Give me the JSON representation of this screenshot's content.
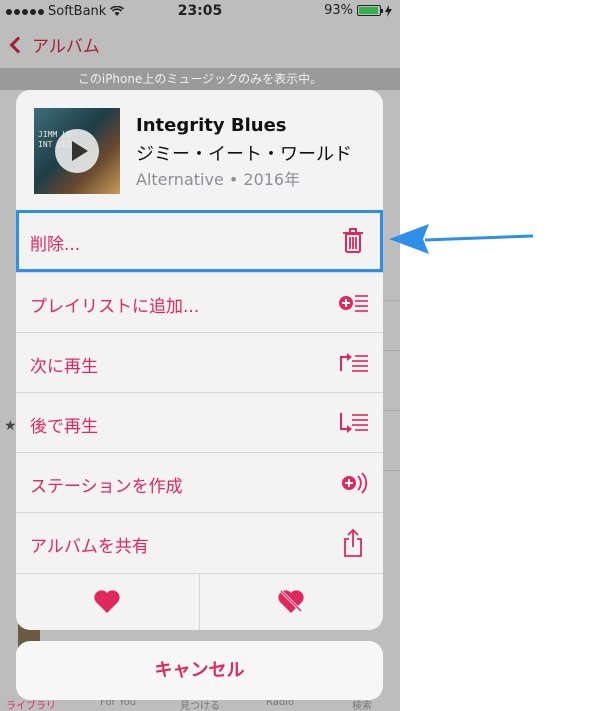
{
  "status_bar": {
    "carrier": "SoftBank",
    "time": "23:05",
    "battery_percent": "93%",
    "battery_level": 0.93
  },
  "nav": {
    "back_label": "アルバム"
  },
  "filter_banner": "このiPhone上のミュージックのみを表示中。",
  "album": {
    "title": "Integrity Blues",
    "artist": "ジミー・イート・ワールド",
    "meta": "Alternative • 2016年",
    "art_text_line1": "JIMM   LD",
    "art_text_line2": "INT    UES"
  },
  "actions": [
    {
      "label": "削除...",
      "icon": "trash-icon"
    },
    {
      "label": "プレイリストに追加...",
      "icon": "add-to-playlist-icon"
    },
    {
      "label": "次に再生",
      "icon": "play-next-icon"
    },
    {
      "label": "後で再生",
      "icon": "play-later-icon"
    },
    {
      "label": "ステーションを作成",
      "icon": "create-station-icon"
    },
    {
      "label": "アルバムを共有",
      "icon": "share-icon"
    }
  ],
  "cancel_label": "キャンセル",
  "tab_bar": {
    "items": [
      "ライブラリ",
      "For You",
      "見つける",
      "Radio",
      "検索"
    ]
  },
  "colors": {
    "accent": "#e0285c",
    "highlight": "#2f8fe8",
    "back": "#a31f35"
  }
}
